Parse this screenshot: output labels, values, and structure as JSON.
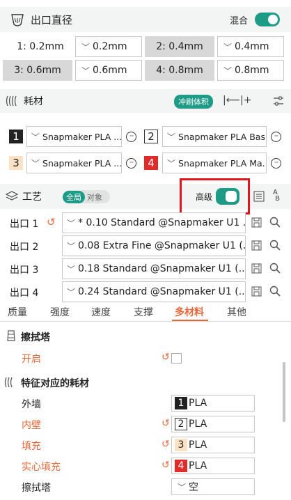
{
  "nozzle": {
    "title": "出口直径",
    "mixed_label": "混合",
    "mixed_on": true,
    "items": [
      {
        "label": "1: 0.2mm",
        "value": "0.2mm",
        "selected": false
      },
      {
        "label": "2: 0.4mm",
        "value": "0.4mm",
        "selected": true
      },
      {
        "label": "3: 0.6mm",
        "value": "0.6mm",
        "selected": true
      },
      {
        "label": "4: 0.8mm",
        "value": "0.8mm",
        "selected": true
      }
    ]
  },
  "filament": {
    "title": "耗材",
    "flush_label": "冲刷体积",
    "items": [
      {
        "num": "1",
        "name": "Snapmaker PLA ...",
        "badge_bg": "#222222",
        "badge_fg": "#ffffff"
      },
      {
        "num": "2",
        "name": "Snapmaker PLA Bas...",
        "badge_bg": "#ffffff",
        "badge_fg": "#222222"
      },
      {
        "num": "3",
        "name": "Snapmaker PLA ...",
        "badge_bg": "#fbe2c4",
        "badge_fg": "#222222"
      },
      {
        "num": "4",
        "name": "Snapmaker PLA Ma...",
        "badge_bg": "#e12a2a",
        "badge_fg": "#ffffff"
      }
    ]
  },
  "process": {
    "title": "工艺",
    "seg_global": "全局",
    "seg_object": "对象",
    "advanced_label": "高级",
    "advanced_on": true,
    "extruders": [
      {
        "label": "出口 1",
        "preset": "* 0.10 Standard @Snapmaker U1 ...",
        "modified": true
      },
      {
        "label": "出口 2",
        "preset": "0.08 Extra Fine @Snapmaker U1 (...",
        "modified": false
      },
      {
        "label": "出口 3",
        "preset": "0.18 Standard @Snapmaker U1 (...",
        "modified": false
      },
      {
        "label": "出口 4",
        "preset": "0.24 Standard @Snapmaker U1 (...",
        "modified": false
      }
    ]
  },
  "tabs": [
    {
      "label": "质量",
      "active": false
    },
    {
      "label": "强度",
      "active": false
    },
    {
      "label": "速度",
      "active": false
    },
    {
      "label": "支撑",
      "active": false
    },
    {
      "label": "多材料",
      "active": true
    },
    {
      "label": "其他",
      "active": false
    }
  ],
  "prime_tower": {
    "title": "擦拭塔",
    "enable_label": "开启",
    "enabled": false
  },
  "feature_filament": {
    "title": "特征对应的耗材",
    "rows": [
      {
        "label": "外墙",
        "num": "1",
        "value": "PLA",
        "modified": false,
        "badge_bg": "#222222",
        "badge_fg": "#ffffff"
      },
      {
        "label": "内壁",
        "num": "2",
        "value": "PLA",
        "modified": true,
        "badge_bg": "#ffffff",
        "badge_fg": "#222222"
      },
      {
        "label": "填充",
        "num": "3",
        "value": "PLA",
        "modified": true,
        "badge_bg": "#fbe2c4",
        "badge_fg": "#222222"
      },
      {
        "label": "实心填充",
        "num": "4",
        "value": "PLA",
        "modified": true,
        "badge_bg": "#e12a2a",
        "badge_fg": "#ffffff"
      }
    ],
    "prime_tower_row": {
      "label": "擦拭塔",
      "value": "空"
    }
  },
  "colors": {
    "accent": "#1e9b86",
    "modified": "#e8683a",
    "highlight_box": "#e0161c"
  }
}
